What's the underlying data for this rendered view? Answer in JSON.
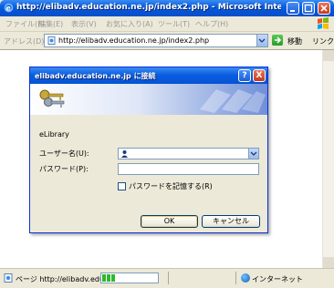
{
  "browser": {
    "title": "http://elibadv.education.ne.jp/index2.php - Microsoft Internet ...",
    "menu": [
      "ファイル(F)",
      "編集(E)",
      "表示(V)",
      "お気に入り(A)",
      "ツール(T)",
      "ヘルプ(H)"
    ],
    "address_label": "アドレス(D)",
    "url": "http://elibadv.education.ne.jp/index2.php",
    "go_label": "移動",
    "links_label": "リンク"
  },
  "status": {
    "text": "ページ http://elibadv.educ",
    "progress_fraction": 0.2,
    "zone": "インターネット"
  },
  "dialog": {
    "title": "elibadv.education.ne.jp に接続",
    "help_glyph": "?",
    "close_glyph": "X",
    "realm": "eLibrary",
    "username_label": "ユーザー名(U):",
    "username_value": "",
    "password_label": "パスワード(P):",
    "password_value": "",
    "remember_label": "パスワードを記憶する(R)",
    "remember_checked": false,
    "ok_label": "OK",
    "cancel_label": "キャンセル"
  },
  "colors": {
    "titlebar": "#0a5ee0",
    "close_button": "#c43b1e",
    "dialog_face": "#ece9d8",
    "progress": "#2fb82a"
  },
  "icons": [
    "ie-icon",
    "minimize-icon",
    "maximize-icon",
    "close-icon",
    "windows-flag-icon",
    "page-icon",
    "go-arrow-icon",
    "keys-icon",
    "user-icon",
    "globe-icon"
  ]
}
